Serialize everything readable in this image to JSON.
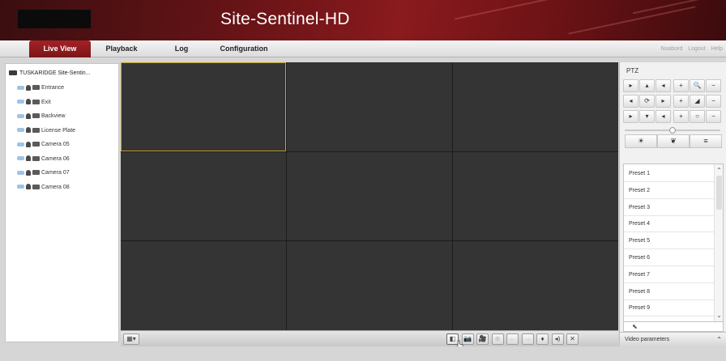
{
  "header": {
    "title": "Site-Sentinel-HD",
    "logo": "redacted-logo"
  },
  "nav": {
    "tabs": [
      {
        "label": "Live View",
        "active": true
      },
      {
        "label": "Playback"
      },
      {
        "label": "Log"
      },
      {
        "label": "Configuration"
      }
    ],
    "user_links": [
      "Noabord",
      "Logout",
      "Help"
    ]
  },
  "tree": {
    "root_label": "TUSKARIDGE Site-Sentin...",
    "cameras": [
      "Entrance",
      "Exit",
      "Backview",
      "License Plate",
      "Camera 05",
      "Camera 06",
      "Camera 07",
      "Camera 08"
    ]
  },
  "grid": {
    "layout": "3x3",
    "selected_cell": 0
  },
  "toolbar": {
    "layout_button": "window-layout-icon",
    "buttons": [
      {
        "name": "stop-all-icon",
        "glyph": "◧",
        "state": "active"
      },
      {
        "name": "capture-icon",
        "glyph": "📷"
      },
      {
        "name": "record-icon",
        "glyph": "🎥"
      },
      {
        "name": "digital-zoom-icon",
        "glyph": "⊕",
        "state": "disabled"
      },
      {
        "name": "prev-page-icon",
        "glyph": "←",
        "state": "disabled"
      },
      {
        "name": "next-page-icon",
        "glyph": "→",
        "state": "disabled"
      },
      {
        "name": "microphone-icon",
        "glyph": "♦"
      },
      {
        "name": "volume-icon",
        "glyph": "◂)"
      },
      {
        "name": "fullscreen-icon",
        "glyph": "✕"
      }
    ]
  },
  "ptz": {
    "title": "PTZ",
    "pad": [
      [
        "▸",
        "▴",
        "◂",
        "+",
        "🔍",
        "−"
      ],
      [
        "◂",
        "⟳",
        "▸",
        "+",
        "◢",
        "−"
      ],
      [
        "▸",
        "▾",
        "◂",
        "+",
        "○",
        "−"
      ]
    ],
    "speed": 0.5,
    "functions": [
      "☀",
      "❦",
      "≡"
    ],
    "presets": [
      "Preset 1",
      "Preset 2",
      "Preset 3",
      "Preset 4",
      "Preset 5",
      "Preset 6",
      "Preset 7",
      "Preset 8",
      "Preset 9"
    ],
    "preset_action_icon": "call-preset-icon",
    "video_parameters_label": "Video parameters"
  }
}
